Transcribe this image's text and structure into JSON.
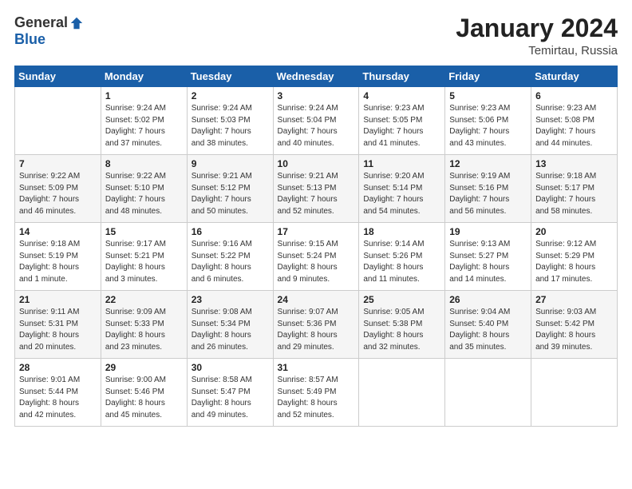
{
  "logo": {
    "general": "General",
    "blue": "Blue"
  },
  "title": "January 2024",
  "location": "Temirtau, Russia",
  "headers": [
    "Sunday",
    "Monday",
    "Tuesday",
    "Wednesday",
    "Thursday",
    "Friday",
    "Saturday"
  ],
  "weeks": [
    [
      {
        "day": "",
        "info": ""
      },
      {
        "day": "1",
        "info": "Sunrise: 9:24 AM\nSunset: 5:02 PM\nDaylight: 7 hours\nand 37 minutes."
      },
      {
        "day": "2",
        "info": "Sunrise: 9:24 AM\nSunset: 5:03 PM\nDaylight: 7 hours\nand 38 minutes."
      },
      {
        "day": "3",
        "info": "Sunrise: 9:24 AM\nSunset: 5:04 PM\nDaylight: 7 hours\nand 40 minutes."
      },
      {
        "day": "4",
        "info": "Sunrise: 9:23 AM\nSunset: 5:05 PM\nDaylight: 7 hours\nand 41 minutes."
      },
      {
        "day": "5",
        "info": "Sunrise: 9:23 AM\nSunset: 5:06 PM\nDaylight: 7 hours\nand 43 minutes."
      },
      {
        "day": "6",
        "info": "Sunrise: 9:23 AM\nSunset: 5:08 PM\nDaylight: 7 hours\nand 44 minutes."
      }
    ],
    [
      {
        "day": "7",
        "info": "Sunrise: 9:22 AM\nSunset: 5:09 PM\nDaylight: 7 hours\nand 46 minutes."
      },
      {
        "day": "8",
        "info": "Sunrise: 9:22 AM\nSunset: 5:10 PM\nDaylight: 7 hours\nand 48 minutes."
      },
      {
        "day": "9",
        "info": "Sunrise: 9:21 AM\nSunset: 5:12 PM\nDaylight: 7 hours\nand 50 minutes."
      },
      {
        "day": "10",
        "info": "Sunrise: 9:21 AM\nSunset: 5:13 PM\nDaylight: 7 hours\nand 52 minutes."
      },
      {
        "day": "11",
        "info": "Sunrise: 9:20 AM\nSunset: 5:14 PM\nDaylight: 7 hours\nand 54 minutes."
      },
      {
        "day": "12",
        "info": "Sunrise: 9:19 AM\nSunset: 5:16 PM\nDaylight: 7 hours\nand 56 minutes."
      },
      {
        "day": "13",
        "info": "Sunrise: 9:18 AM\nSunset: 5:17 PM\nDaylight: 7 hours\nand 58 minutes."
      }
    ],
    [
      {
        "day": "14",
        "info": "Sunrise: 9:18 AM\nSunset: 5:19 PM\nDaylight: 8 hours\nand 1 minute."
      },
      {
        "day": "15",
        "info": "Sunrise: 9:17 AM\nSunset: 5:21 PM\nDaylight: 8 hours\nand 3 minutes."
      },
      {
        "day": "16",
        "info": "Sunrise: 9:16 AM\nSunset: 5:22 PM\nDaylight: 8 hours\nand 6 minutes."
      },
      {
        "day": "17",
        "info": "Sunrise: 9:15 AM\nSunset: 5:24 PM\nDaylight: 8 hours\nand 9 minutes."
      },
      {
        "day": "18",
        "info": "Sunrise: 9:14 AM\nSunset: 5:26 PM\nDaylight: 8 hours\nand 11 minutes."
      },
      {
        "day": "19",
        "info": "Sunrise: 9:13 AM\nSunset: 5:27 PM\nDaylight: 8 hours\nand 14 minutes."
      },
      {
        "day": "20",
        "info": "Sunrise: 9:12 AM\nSunset: 5:29 PM\nDaylight: 8 hours\nand 17 minutes."
      }
    ],
    [
      {
        "day": "21",
        "info": "Sunrise: 9:11 AM\nSunset: 5:31 PM\nDaylight: 8 hours\nand 20 minutes."
      },
      {
        "day": "22",
        "info": "Sunrise: 9:09 AM\nSunset: 5:33 PM\nDaylight: 8 hours\nand 23 minutes."
      },
      {
        "day": "23",
        "info": "Sunrise: 9:08 AM\nSunset: 5:34 PM\nDaylight: 8 hours\nand 26 minutes."
      },
      {
        "day": "24",
        "info": "Sunrise: 9:07 AM\nSunset: 5:36 PM\nDaylight: 8 hours\nand 29 minutes."
      },
      {
        "day": "25",
        "info": "Sunrise: 9:05 AM\nSunset: 5:38 PM\nDaylight: 8 hours\nand 32 minutes."
      },
      {
        "day": "26",
        "info": "Sunrise: 9:04 AM\nSunset: 5:40 PM\nDaylight: 8 hours\nand 35 minutes."
      },
      {
        "day": "27",
        "info": "Sunrise: 9:03 AM\nSunset: 5:42 PM\nDaylight: 8 hours\nand 39 minutes."
      }
    ],
    [
      {
        "day": "28",
        "info": "Sunrise: 9:01 AM\nSunset: 5:44 PM\nDaylight: 8 hours\nand 42 minutes."
      },
      {
        "day": "29",
        "info": "Sunrise: 9:00 AM\nSunset: 5:46 PM\nDaylight: 8 hours\nand 45 minutes."
      },
      {
        "day": "30",
        "info": "Sunrise: 8:58 AM\nSunset: 5:47 PM\nDaylight: 8 hours\nand 49 minutes."
      },
      {
        "day": "31",
        "info": "Sunrise: 8:57 AM\nSunset: 5:49 PM\nDaylight: 8 hours\nand 52 minutes."
      },
      {
        "day": "",
        "info": ""
      },
      {
        "day": "",
        "info": ""
      },
      {
        "day": "",
        "info": ""
      }
    ]
  ]
}
